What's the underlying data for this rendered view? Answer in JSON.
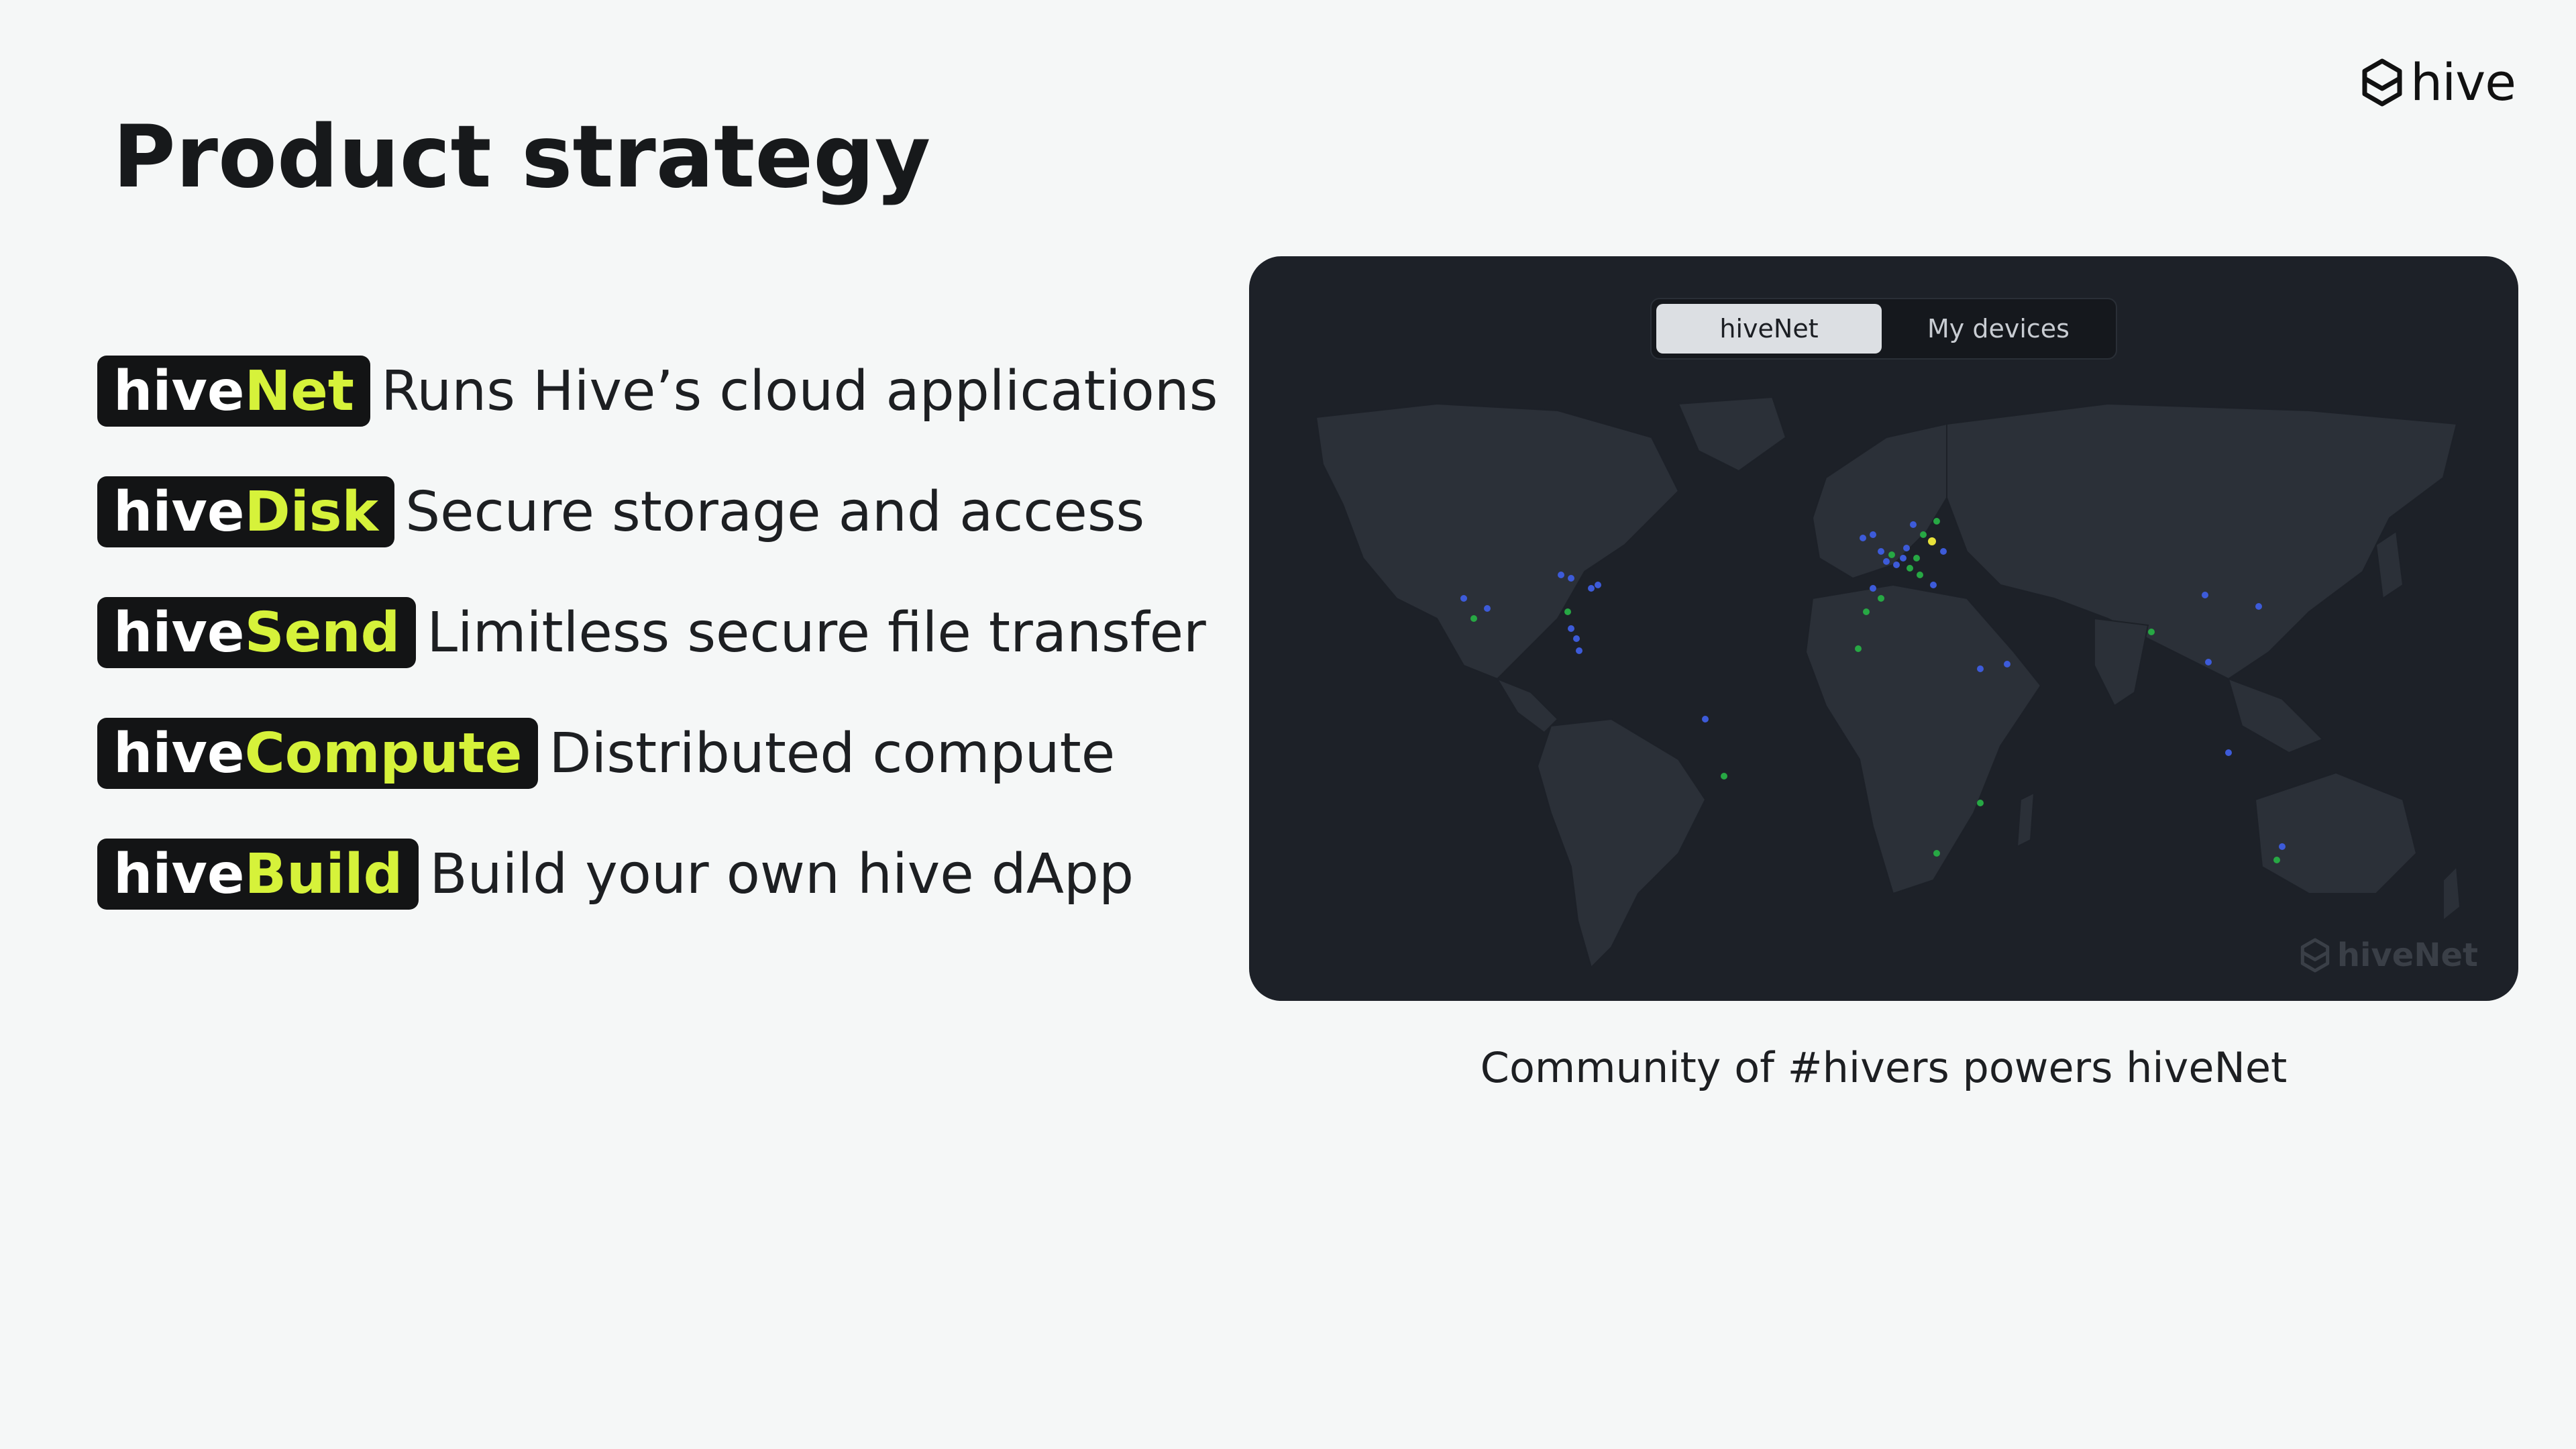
{
  "logo": {
    "icon": "hive-hexagon-icon",
    "text": "hive"
  },
  "title": {
    "strong": "Product",
    "rest": " strategy"
  },
  "products": [
    {
      "prefix": "hive",
      "suffix": "Net",
      "description": "Runs Hive’s cloud applications"
    },
    {
      "prefix": "hive",
      "suffix": "Disk",
      "description": "Secure storage and access"
    },
    {
      "prefix": "hive",
      "suffix": "Send",
      "description": "Limitless secure file transfer"
    },
    {
      "prefix": "hive",
      "suffix": "Compute",
      "description": "Distributed compute"
    },
    {
      "prefix": "hive",
      "suffix": "Build",
      "description": "Build your own hive dApp"
    }
  ],
  "map_panel": {
    "tabs": [
      {
        "label": "hiveNet",
        "active": true
      },
      {
        "label": "My devices",
        "active": false
      }
    ],
    "watermark": "hiveNet",
    "colors": {
      "blue_node": "#3d5bd9",
      "green_node": "#27a844",
      "yellow_node": "#e8e23a"
    }
  },
  "caption": "Community of #hivers powers hiveNet",
  "colors": {
    "accent": "#d6f23a",
    "badge_bg": "#131415",
    "panel_bg": "#1d2128"
  }
}
